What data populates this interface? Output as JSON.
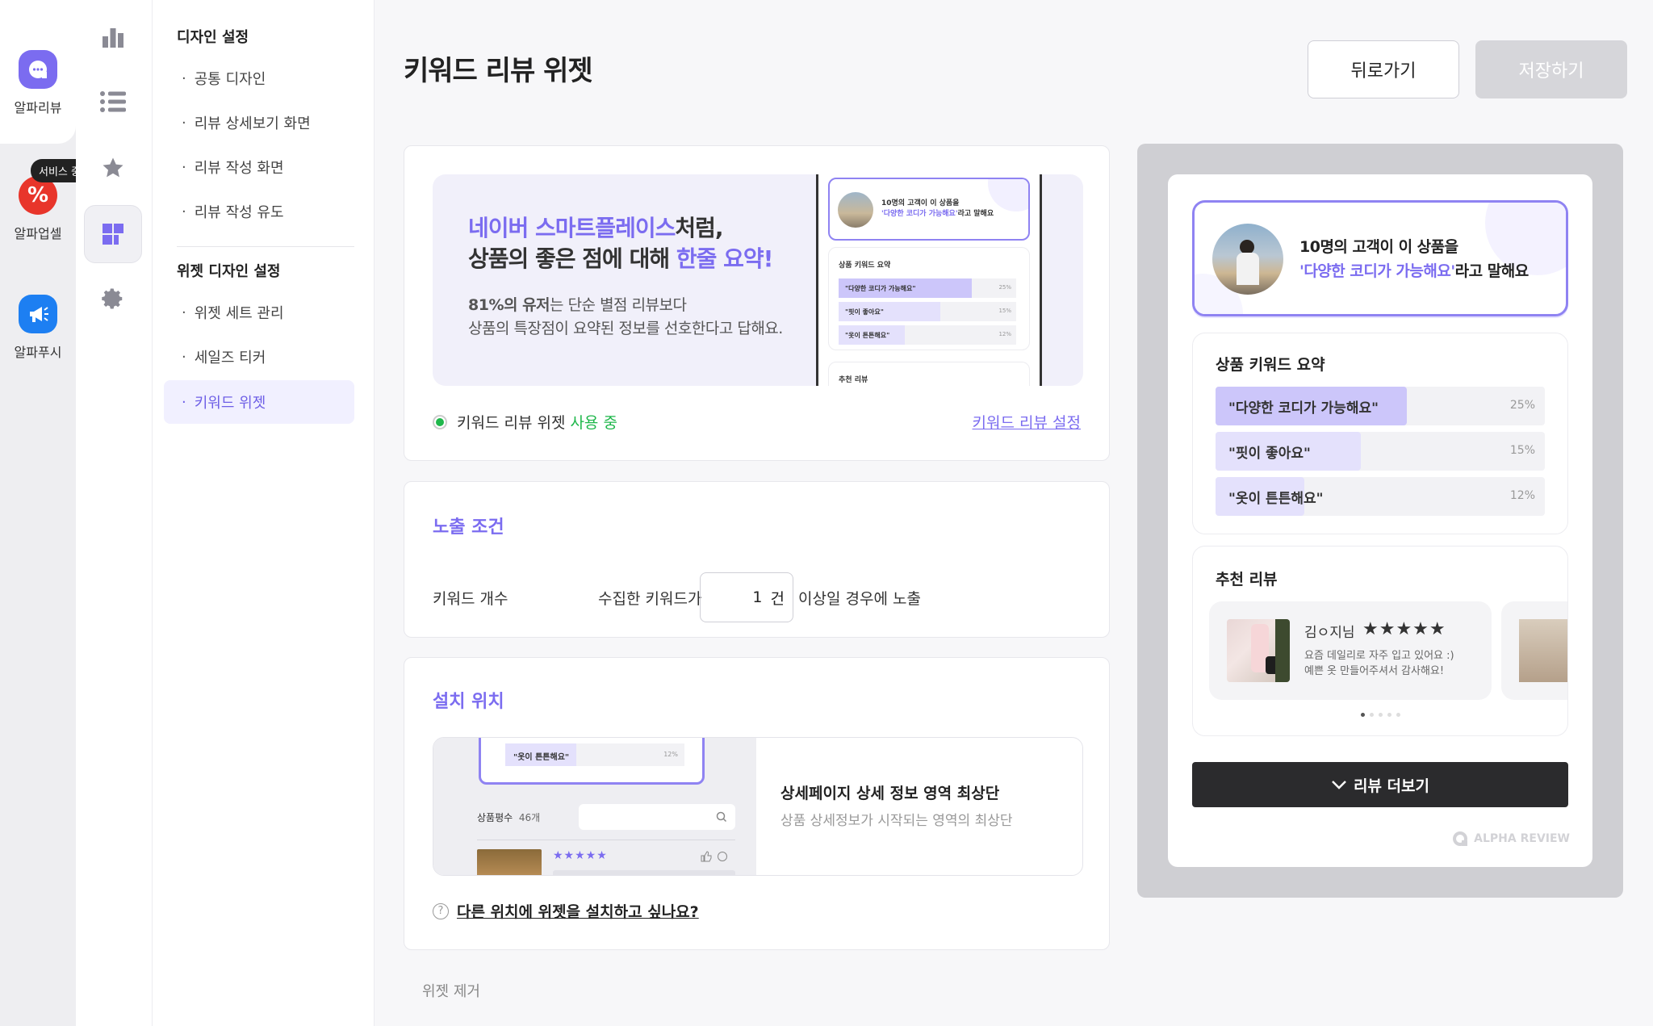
{
  "app_rail": {
    "apps": [
      {
        "label": "알파리뷰"
      },
      {
        "label": "알파업셀",
        "badge": "서비스 중단"
      },
      {
        "label": "알파푸시"
      }
    ]
  },
  "menu": {
    "section1": "디자인 설정",
    "section1_items": [
      "공통 디자인",
      "리뷰 상세보기 화면",
      "리뷰 작성 화면",
      "리뷰 작성 유도"
    ],
    "section2": "위젯 디자인 설정",
    "section2_items": [
      "위젯 세트 관리",
      "세일즈 티커",
      "키워드 위젯"
    ],
    "active_item": "키워드 위젯"
  },
  "header": {
    "title": "키워드 리뷰 위젯",
    "back_label": "뒤로가기",
    "save_label": "저장하기"
  },
  "intro": {
    "headline_part1": "네이버 스마트플레이스",
    "headline_part2": "처럼,",
    "headline_part3": "상품의 좋은 점에 대해 ",
    "headline_part4": "한줄 요약!",
    "body_bold": "81%의 유저",
    "body_part1": "는 단순 별점 리뷰보다",
    "body_line2": "상품의 특장점이 요약된 정보를 선호한다고 답해요.",
    "status_label": "키워드 리뷰 위젯",
    "status_value": "사용 중",
    "settings_link": "키워드 리뷰 설정"
  },
  "exposure": {
    "title": "노출 조건",
    "keyword_count_label": "키워드 개수",
    "prefix": "수집한 키워드가",
    "value": "1",
    "unit": "건",
    "suffix": "이상일 경우에 노출"
  },
  "install": {
    "title": "설치 위치",
    "location_title": "상세페이지 상세 정보 영역 최상단",
    "location_desc": "상품 상세정보가 시작되는 영역의 최상단",
    "thumb_keyword": "\"옷이 튼튼해요\"",
    "thumb_pct": "12%",
    "thumb_rating_label": "상품평수",
    "thumb_rating_count": "46개",
    "help_text": "다른 위치에 위젯을 설치하고 싶나요?",
    "help_mark": "?"
  },
  "remove_label": "위젯 제거",
  "mini_phone": {
    "top_line1": "10명의 고객이 이 상품을",
    "top_line2_hl": "'다양한 코디가 가능해요'",
    "top_line2_rest": "라고 말해요",
    "summary_title": "상품 키워드 요약",
    "rows": [
      {
        "label": "\"다양한 코디가 가능해요\"",
        "pct": "25%"
      },
      {
        "label": "\"핏이 좋아요\"",
        "pct": "15%"
      },
      {
        "label": "\"옷이 튼튼해요\"",
        "pct": "12%"
      }
    ],
    "recommend_title": "추천 리뷰"
  },
  "preview": {
    "top_line1": "10명의 고객이 이 상품을",
    "top_line2_hl": "'다양한 코디가 가능해요'",
    "top_line2_rest": "라고 말해요",
    "summary_title": "상품 키워드 요약",
    "keywords": [
      {
        "label": "\"다양한 코디가 가능해요\"",
        "pct": "25%",
        "value": 0.58
      },
      {
        "label": "\"핏이 좋아요\"",
        "pct": "15%",
        "value": 0.44
      },
      {
        "label": "\"옷이 튼튼해요\"",
        "pct": "12%",
        "value": 0.27
      }
    ],
    "recommend_title": "추천 리뷰",
    "review_name": "김ㅇ지님",
    "review_stars": "★★★★★",
    "review_line1": "요즘 데일리로 자주 입고 있어요 :)",
    "review_line2": "예쁜 옷 만들어주셔서 감사해요!",
    "more_label": "리뷰 더보기",
    "brand": "ALPHA REVIEW"
  },
  "colors": {
    "accent": "#7b6cf0",
    "status_green": "#1fb74b",
    "dark_button": "#2b2b2d"
  }
}
